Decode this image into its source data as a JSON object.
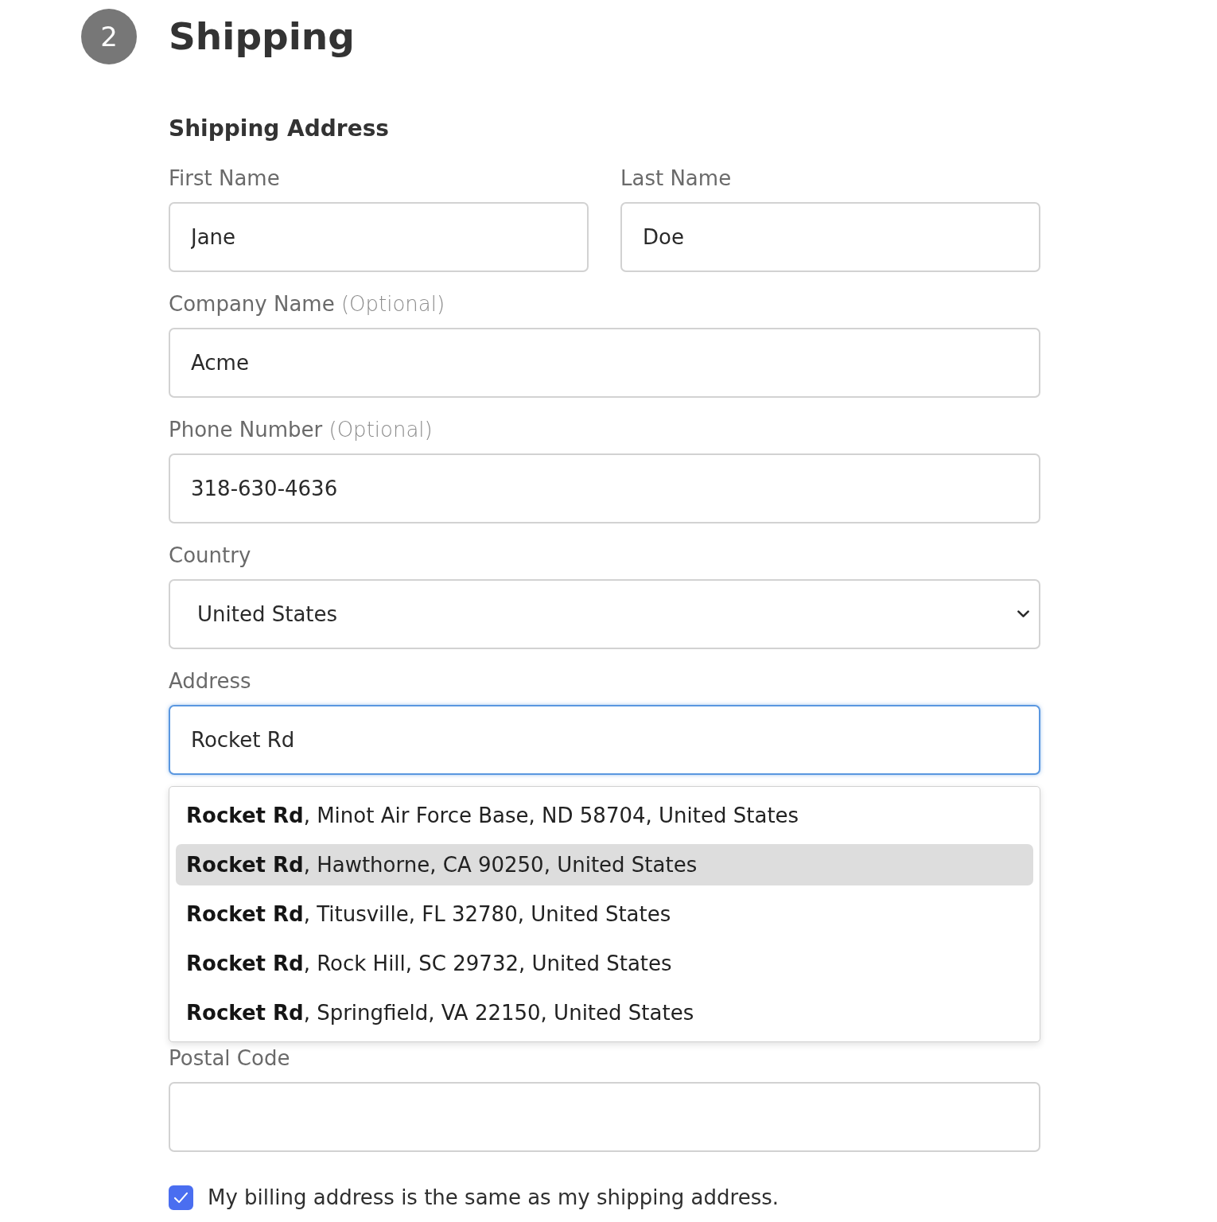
{
  "step": {
    "number": "2",
    "title": "Shipping"
  },
  "section_title": "Shipping Address",
  "rows": [
    {
      "fields": [
        {
          "kind": "text",
          "label": "First Name",
          "value": "Jane",
          "focused": false
        },
        {
          "kind": "text",
          "label": "Last Name",
          "value": "Doe",
          "focused": false
        }
      ]
    },
    {
      "fields": [
        {
          "kind": "text",
          "label": "Company Name",
          "note": "(Optional)",
          "value": "Acme",
          "focused": false
        }
      ]
    },
    {
      "fields": [
        {
          "kind": "text",
          "label": "Phone Number",
          "note": "(Optional)",
          "value": "318-630-4636",
          "focused": false
        }
      ]
    },
    {
      "fields": [
        {
          "kind": "select",
          "label": "Country",
          "value": "United States"
        }
      ]
    },
    {
      "fields": [
        {
          "kind": "text",
          "label": "Address",
          "value": "Rocket Rd",
          "focused": true,
          "suggestions": [
            {
              "text": "**Rocket Rd**, Minot Air Force Base, ND 58704, United States",
              "selected": false
            },
            {
              "text": "**Rocket Rd**, Hawthorne, CA 90250, United States",
              "selected": true
            },
            {
              "text": "**Rocket Rd**, Titusville, FL 32780, United States",
              "selected": false
            },
            {
              "text": "**Rocket Rd**, Rock Hill, SC 29732, United States",
              "selected": false
            },
            {
              "text": "**Rocket Rd**, Springfield, VA 22150, United States",
              "selected": false
            }
          ]
        }
      ]
    },
    {
      "fields": [
        {
          "kind": "text",
          "label": "Postal Code",
          "focused": false
        }
      ]
    }
  ],
  "billing_same": {
    "label": "My billing address is the same as my shipping address.",
    "checked": true
  }
}
